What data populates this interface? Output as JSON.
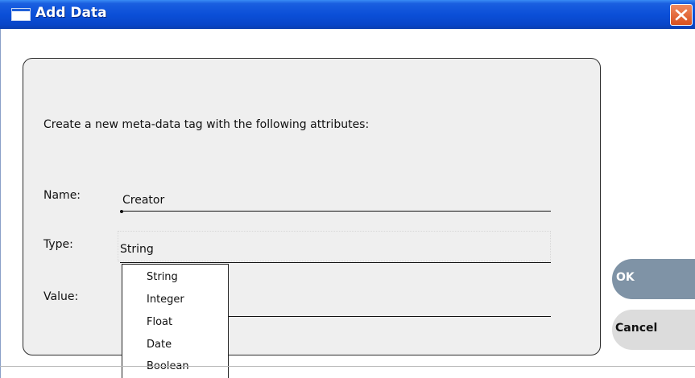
{
  "window": {
    "title": "Add Data",
    "accent_color": "#0b4fd8",
    "close_color": "#d8501e"
  },
  "dialog": {
    "instructions": "Create a new meta-data tag with the following attributes:",
    "fields": {
      "name_label": "Name:",
      "name_value": "Creator",
      "type_label": "Type:",
      "type_value": "String",
      "value_label": "Value:",
      "value_value": ""
    },
    "type_options": [
      "String",
      "Integer",
      "Float",
      "Date",
      "Boolean"
    ]
  },
  "buttons": {
    "ok_label": "OK",
    "cancel_label": "Cancel",
    "ok_color": "#7f93a6",
    "cancel_color": "#dcdcdc"
  },
  "icons": {
    "window_icon": "window-icon",
    "close_icon": "close-x-icon"
  }
}
